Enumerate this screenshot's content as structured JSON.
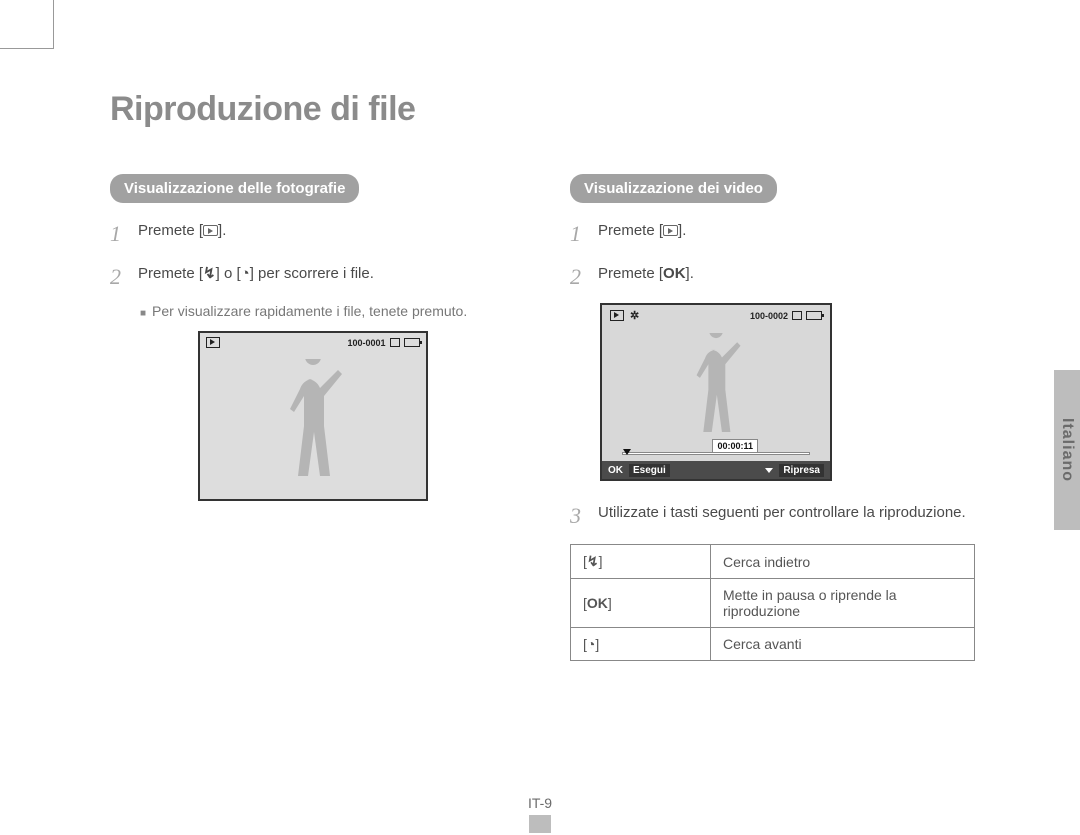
{
  "page": {
    "title": "Riproduzione di file",
    "language_tab": "Italiano",
    "page_number": "IT-9"
  },
  "left": {
    "heading": "Visualizzazione delle fotografie",
    "step1": "Premete [",
    "step1_end": "].",
    "step2_a": "Premete [",
    "step2_mid": "] o [",
    "step2_b": "] per scorrere i file.",
    "sub_note": "Per visualizzare rapidamente i file, tenete premuto.",
    "lcd_file": "100-0001"
  },
  "right": {
    "heading": "Visualizzazione dei video",
    "step1": "Premete [",
    "step1_end": "].",
    "step2": "Premete [",
    "step2_end": "].",
    "lcd_file": "100-0002",
    "lcd_time": "00:00:11",
    "soft_left_key": "OK",
    "soft_left": "Esegui",
    "soft_right": "Ripresa",
    "step3": "Utilizzate i tasti seguenti per controllare la riproduzione.",
    "table": {
      "r1_desc": "Cerca indietro",
      "r2_key": "OK",
      "r2_desc": "Mette in pausa o riprende la riproduzione",
      "r3_desc": "Cerca avanti"
    }
  }
}
